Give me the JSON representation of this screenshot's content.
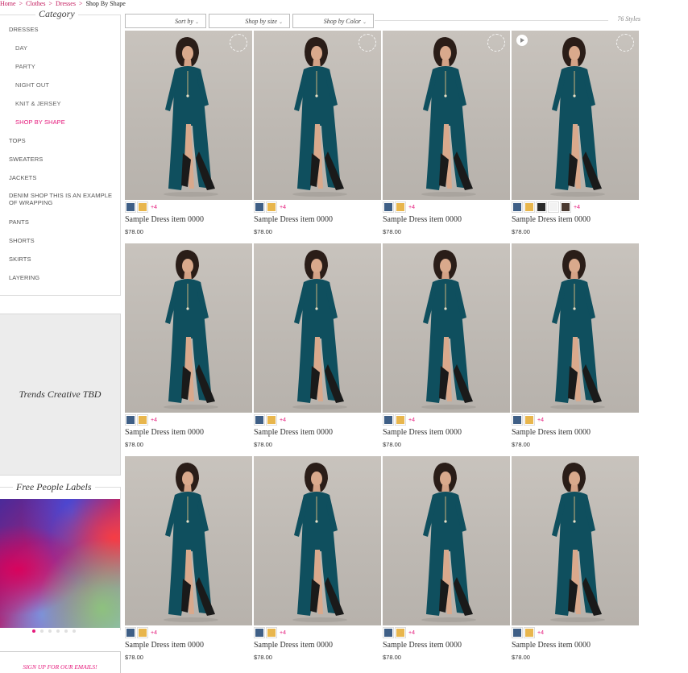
{
  "breadcrumb": [
    {
      "label": "Home",
      "link": true
    },
    {
      "label": "Clothes",
      "link": true
    },
    {
      "label": "Dresses",
      "link": true
    },
    {
      "label": "Shop By Shape",
      "link": false
    }
  ],
  "breadcrumb_sep": ">",
  "category": {
    "title": "Category",
    "items": [
      {
        "label": "DRESSES",
        "kind": "top"
      },
      {
        "label": "DAY",
        "kind": "sub"
      },
      {
        "label": "PARTY",
        "kind": "sub"
      },
      {
        "label": "NIGHT OUT",
        "kind": "sub"
      },
      {
        "label": "KNIT & JERSEY",
        "kind": "sub"
      },
      {
        "label": "SHOP BY SHAPE",
        "kind": "active"
      },
      {
        "label": "TOPS",
        "kind": "top"
      },
      {
        "label": "SWEATERS",
        "kind": "top"
      },
      {
        "label": "JACKETS",
        "kind": "top"
      },
      {
        "label": "DENIM SHOP THIS IS AN EXAMPLE OF WRAPPING",
        "kind": "wrap"
      },
      {
        "label": "PANTS",
        "kind": "top"
      },
      {
        "label": "SHORTS",
        "kind": "top"
      },
      {
        "label": "SKIRTS",
        "kind": "top"
      },
      {
        "label": "LAYERING",
        "kind": "top"
      }
    ]
  },
  "trends": {
    "label": "Trends Creative TBD"
  },
  "labels": {
    "title": "Free People Labels",
    "active_dot": 0,
    "dot_count": 6
  },
  "signup": {
    "label": "SIGN UP FOR OUR EMAILS!"
  },
  "toolbar": {
    "sort_label": "Sort by",
    "size_label": "Shop by size",
    "color_label": "Shop by Color",
    "count": "76 Styles",
    "chevron": "⌄"
  },
  "colors": {
    "accent": "#e5197b",
    "navy_swatch": "#3f5f86",
    "gold_swatch": "#e8b64d",
    "dress": "#0f4f5e"
  },
  "products": [
    {
      "name": "Sample Dress item 0000",
      "price": "$78.00",
      "swatches": [
        "#3f5f86",
        "#e8b64d"
      ],
      "more": "+4",
      "badge": "ring"
    },
    {
      "name": "Sample Dress item 0000",
      "price": "$78.00",
      "swatches": [
        "#3f5f86",
        "#e8b64d"
      ],
      "more": "+4",
      "badge": "ring"
    },
    {
      "name": "Sample Dress item 0000",
      "price": "$78.00",
      "swatches": [
        "#3f5f86",
        "#e8b64d"
      ],
      "more": "+4",
      "badge": "ring"
    },
    {
      "name": "Sample Dress item 0000",
      "price": "$78.00",
      "swatches": [
        "#3f5f86",
        "#e8b64d",
        "#2a2a2a",
        "#f2f2f2",
        "#4a3a30"
      ],
      "more": "+4",
      "badge": "play-ring"
    },
    {
      "name": "Sample Dress item 0000",
      "price": "$78.00",
      "swatches": [
        "#3f5f86",
        "#e8b64d"
      ],
      "more": "+4",
      "badge": ""
    },
    {
      "name": "Sample Dress item 0000",
      "price": "$78.00",
      "swatches": [
        "#3f5f86",
        "#e8b64d"
      ],
      "more": "+4",
      "badge": ""
    },
    {
      "name": "Sample Dress item 0000",
      "price": "$78.00",
      "swatches": [
        "#3f5f86",
        "#e8b64d"
      ],
      "more": "+4",
      "badge": ""
    },
    {
      "name": "Sample Dress item 0000",
      "price": "$78.00",
      "swatches": [
        "#3f5f86",
        "#e8b64d"
      ],
      "more": "+4",
      "badge": ""
    },
    {
      "name": "Sample Dress item 0000",
      "price": "$78.00",
      "swatches": [
        "#3f5f86",
        "#e8b64d"
      ],
      "more": "+4",
      "badge": ""
    },
    {
      "name": "Sample Dress item 0000",
      "price": "$78.00",
      "swatches": [
        "#3f5f86",
        "#e8b64d"
      ],
      "more": "+4",
      "badge": ""
    },
    {
      "name": "Sample Dress item 0000",
      "price": "$78.00",
      "swatches": [
        "#3f5f86",
        "#e8b64d"
      ],
      "more": "+4",
      "badge": ""
    },
    {
      "name": "Sample Dress item 0000",
      "price": "$78.00",
      "swatches": [
        "#3f5f86",
        "#e8b64d"
      ],
      "more": "+4",
      "badge": ""
    }
  ]
}
